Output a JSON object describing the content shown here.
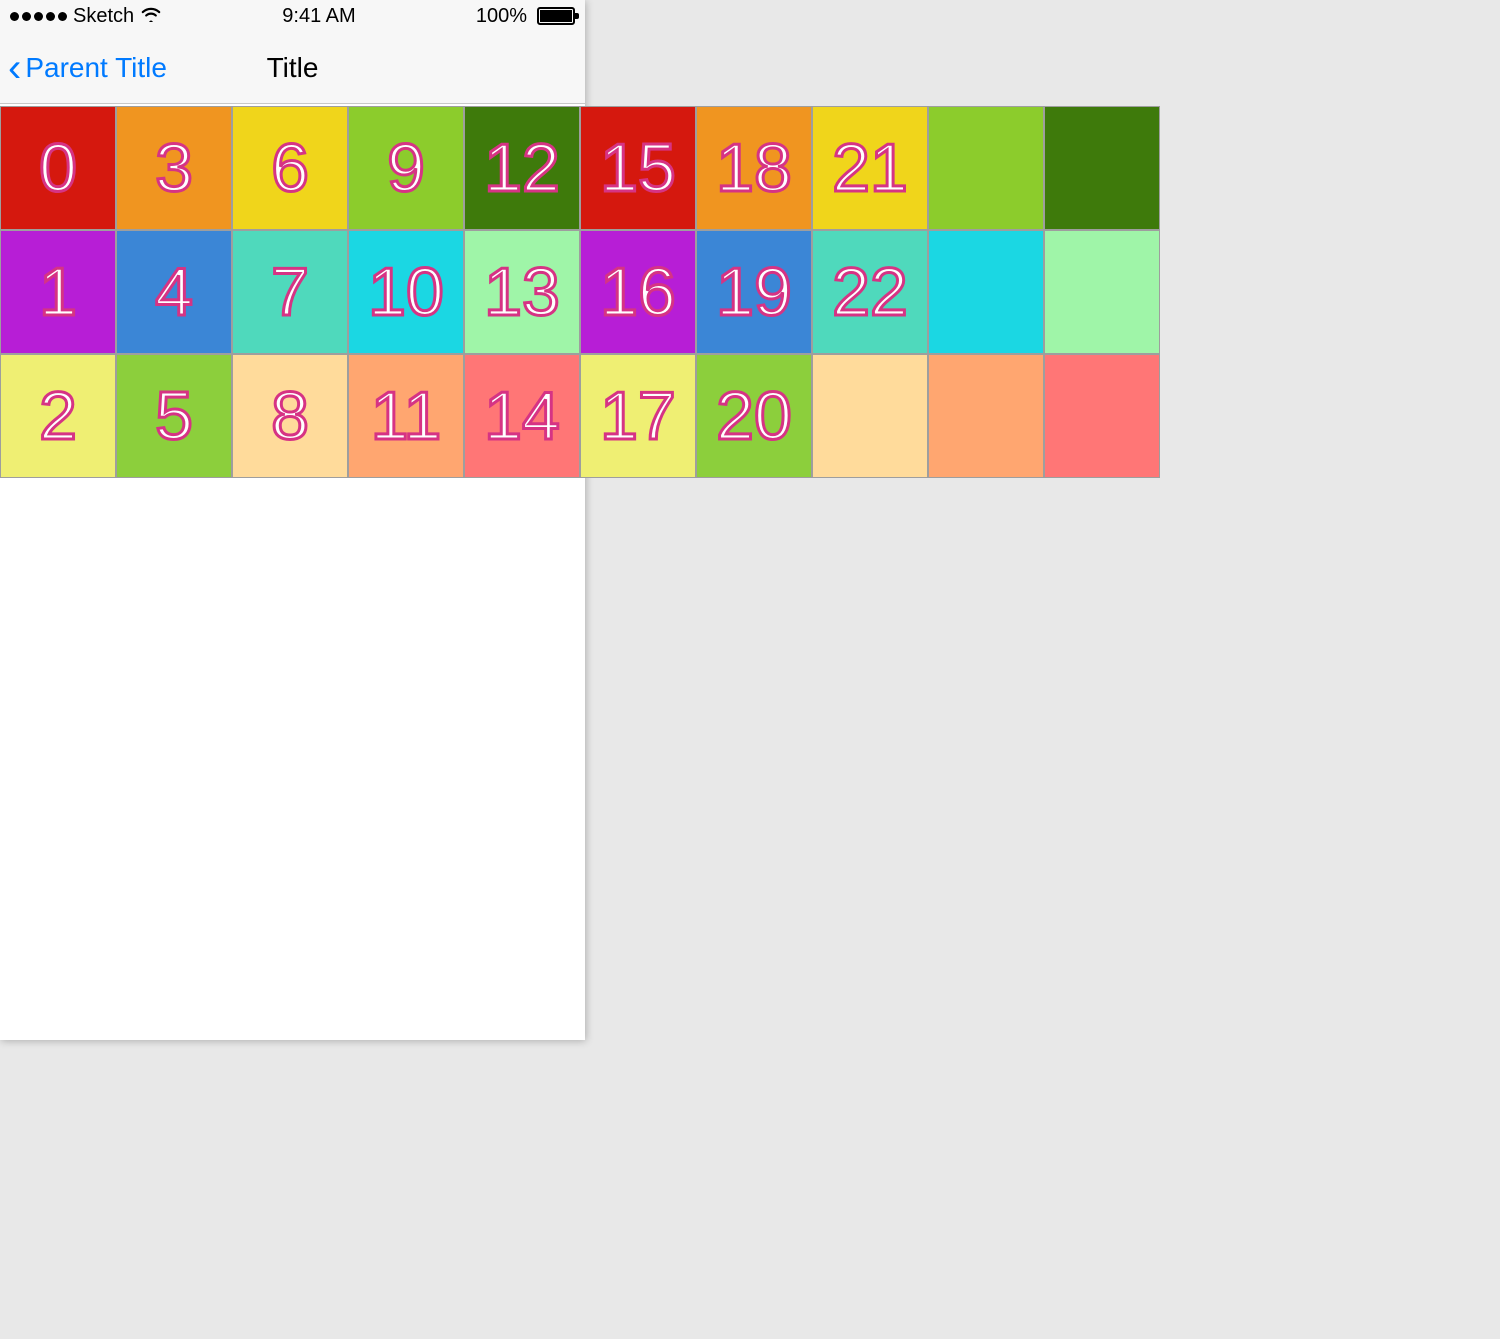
{
  "status_bar": {
    "carrier": "Sketch",
    "time": "9:41 AM",
    "battery_pct": "100%"
  },
  "nav": {
    "back_label": "Parent Title",
    "title": "Title"
  },
  "grid": {
    "columns": 10,
    "rows": 3,
    "cells": [
      {
        "label": "0",
        "color": "#d5180e"
      },
      {
        "label": "1",
        "color": "#b71ed6"
      },
      {
        "label": "2",
        "color": "#efef73"
      },
      {
        "label": "3",
        "color": "#f09520"
      },
      {
        "label": "4",
        "color": "#3b86d6"
      },
      {
        "label": "5",
        "color": "#8ccf3c"
      },
      {
        "label": "6",
        "color": "#f0d51b"
      },
      {
        "label": "7",
        "color": "#4fd9bc"
      },
      {
        "label": "8",
        "color": "#ffdb9b"
      },
      {
        "label": "9",
        "color": "#8ccc2c"
      },
      {
        "label": "10",
        "color": "#1bd7e3"
      },
      {
        "label": "11",
        "color": "#ffa670"
      },
      {
        "label": "12",
        "color": "#3e7a0b"
      },
      {
        "label": "13",
        "color": "#9ff5a8"
      },
      {
        "label": "14",
        "color": "#ff7676"
      },
      {
        "label": "15",
        "color": "#d5180e"
      },
      {
        "label": "16",
        "color": "#b71ed6"
      },
      {
        "label": "17",
        "color": "#efef73"
      },
      {
        "label": "18",
        "color": "#f09520"
      },
      {
        "label": "19",
        "color": "#3b86d6"
      },
      {
        "label": "20",
        "color": "#8ccf3c"
      },
      {
        "label": "21",
        "color": "#f0d51b"
      },
      {
        "label": "22",
        "color": "#4fd9bc"
      },
      {
        "label": "",
        "color": "#ffdb9b"
      },
      {
        "label": "",
        "color": "#8ccc2c"
      },
      {
        "label": "",
        "color": "#1bd7e3"
      },
      {
        "label": "",
        "color": "#ffa670"
      },
      {
        "label": "",
        "color": "#3e7a0b"
      },
      {
        "label": "",
        "color": "#9ff5a8"
      },
      {
        "label": "",
        "color": "#ff7676"
      }
    ]
  }
}
